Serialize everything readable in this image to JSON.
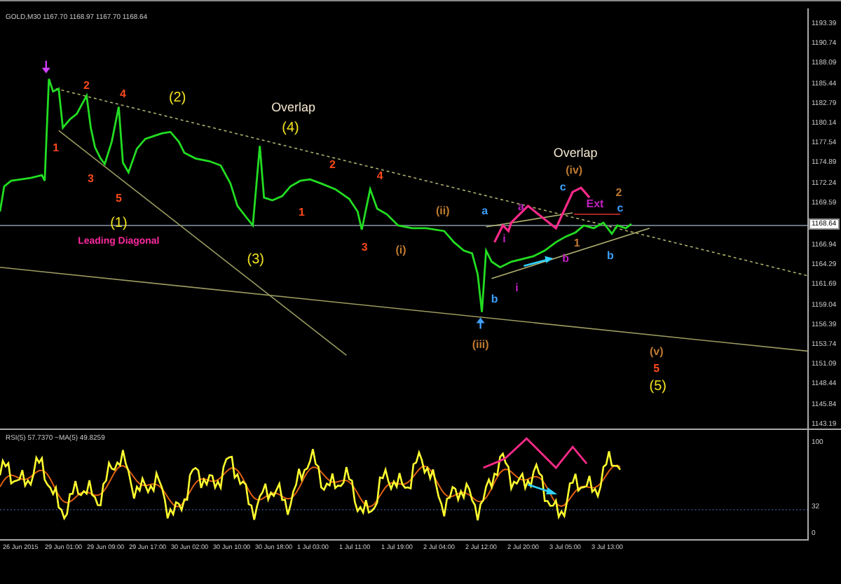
{
  "symbol_header": "GOLD,M30  1167.70 1168.97 1167.70 1168.64",
  "price_axis": {
    "ticks": [
      "1193.39",
      "1190.74",
      "1188.09",
      "1185.44",
      "1182.79",
      "1180.14",
      "1177.54",
      "1174.89",
      "1172.24",
      "1169.59",
      "1166.94",
      "1164.29",
      "1161.69",
      "1159.04",
      "1156.39",
      "1153.74",
      "1151.09",
      "1148.44",
      "1145.84",
      "1143.19"
    ],
    "current_price": "1168.64"
  },
  "annotations": [
    {
      "text": "1",
      "color": "#ff4a1c"
    },
    {
      "text": "2",
      "color": "#ff4a1c"
    },
    {
      "text": "3",
      "color": "#ff4a1c"
    },
    {
      "text": "4",
      "color": "#ff4a1c"
    },
    {
      "text": "5",
      "color": "#ff4a1c"
    },
    {
      "text": "(1)",
      "color": "#f0e020"
    },
    {
      "text": "(2)",
      "color": "#f0e020"
    },
    {
      "text": "Leading Diagonal",
      "color": "#ff2aa0"
    },
    {
      "text": "Overlap",
      "color": "#f4e8d0"
    },
    {
      "text": "(4)",
      "color": "#f0e020"
    },
    {
      "text": "(3)",
      "color": "#f0e020"
    },
    {
      "text": "2",
      "color": "#ff4a1c"
    },
    {
      "text": "4",
      "color": "#ff4a1c"
    },
    {
      "text": "1",
      "color": "#ff4a1c"
    },
    {
      "text": "3",
      "color": "#ff4a1c"
    },
    {
      "text": "(i)",
      "color": "#c07a30"
    },
    {
      "text": "(ii)",
      "color": "#c07a30"
    },
    {
      "text": "a",
      "color": "#3aa0ff"
    },
    {
      "text": "a",
      "color": "#c020c0"
    },
    {
      "text": "i",
      "color": "#c020c0"
    },
    {
      "text": "b",
      "color": "#3aa0ff"
    },
    {
      "text": "(iii)",
      "color": "#c07a30"
    },
    {
      "text": "Overlap",
      "color": "#f4e8d0"
    },
    {
      "text": "(iv)",
      "color": "#c07a30"
    },
    {
      "text": "c",
      "color": "#3aa0ff"
    },
    {
      "text": "Ext",
      "color": "#c020c0"
    },
    {
      "text": "1",
      "color": "#c07a30"
    },
    {
      "text": "b",
      "color": "#c020c0"
    },
    {
      "text": "i",
      "color": "#c020c0"
    },
    {
      "text": "2",
      "color": "#c07a30"
    },
    {
      "text": "c",
      "color": "#3aa0ff"
    },
    {
      "text": "b",
      "color": "#3aa0ff"
    },
    {
      "text": "(v)",
      "color": "#c07a30"
    },
    {
      "text": "5",
      "color": "#ff4a1c"
    },
    {
      "text": "(5)",
      "color": "#f0e020"
    }
  ],
  "indicator": {
    "header": "RSI(5) 57.7370  ~MA(5) 49.8259",
    "ticks": [
      "100",
      "32",
      "0"
    ]
  },
  "time_axis": [
    "26 Jun 2015",
    "29 Jun 01:00",
    "29 Jun 09:00",
    "29 Jun 17:00",
    "30 Jun 02:00",
    "30 Jun 10:00",
    "30 Jun 18:00",
    "1 Jul 03:00",
    "1 Jul 11:00",
    "1 Jul 19:00",
    "2 Jul 04:00",
    "2 Jul 12:00",
    "2 Jul 20:00",
    "3 Jul 05:00",
    "3 Jul 13:00"
  ]
}
